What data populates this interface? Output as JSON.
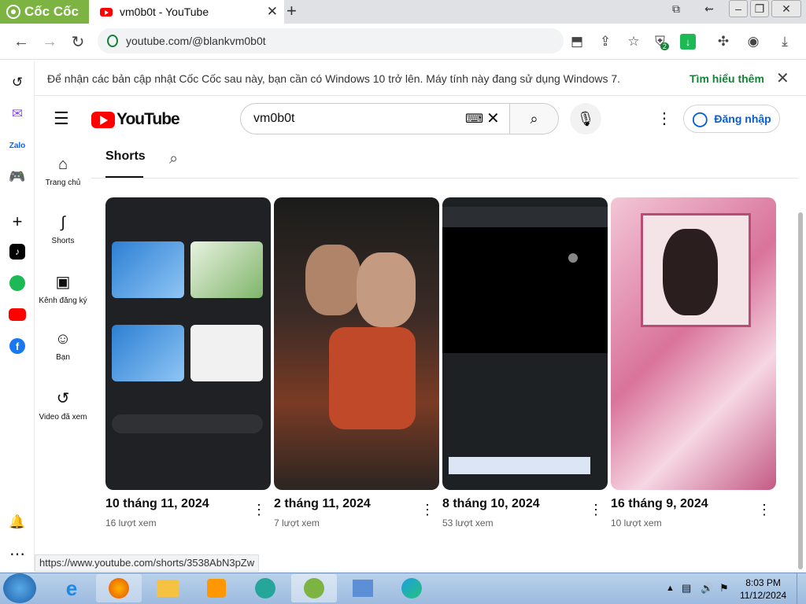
{
  "browser": {
    "brand": "Cốc Cốc",
    "tab_title": "vm0b0t - YouTube",
    "url": "youtube.com/@blankvm0b0t",
    "extension_badge": "2",
    "status_url": "https://www.youtube.com/shorts/3538AbN3pZw"
  },
  "infobar": {
    "message": "Để nhận các bản cập nhật Cốc Cốc sau này, bạn cần có Windows 10 trở lên. Máy tính này đang sử dụng Windows 7.",
    "learn_more": "Tìm hiểu thêm"
  },
  "youtube": {
    "logo_text": "YouTube",
    "search_value": "vm0b0t",
    "sign_in": "Đăng nhập",
    "guide": [
      {
        "label": "Trang chủ",
        "icon": "home-icon"
      },
      {
        "label": "Shorts",
        "icon": "shorts-icon"
      },
      {
        "label": "Kênh đăng ký",
        "icon": "subscriptions-icon"
      },
      {
        "label": "Bạn",
        "icon": "you-icon"
      },
      {
        "label": "Video đã xem",
        "icon": "history-icon"
      }
    ],
    "tab_active": "Shorts",
    "shorts": [
      {
        "date": "10 tháng 11, 2024",
        "views": "16 lượt xem"
      },
      {
        "date": "2 tháng 11, 2024",
        "views": "7 lượt xem"
      },
      {
        "date": "8 tháng 10, 2024",
        "views": "53 lượt xem"
      },
      {
        "date": "16 tháng 9, 2024",
        "views": "10 lượt xem"
      }
    ]
  },
  "taskbar": {
    "time": "8:03 PM",
    "date": "11/12/2024"
  },
  "colors": {
    "brand_green": "#7cb342",
    "youtube_red": "#ff0000",
    "link_blue": "#065fd4"
  }
}
